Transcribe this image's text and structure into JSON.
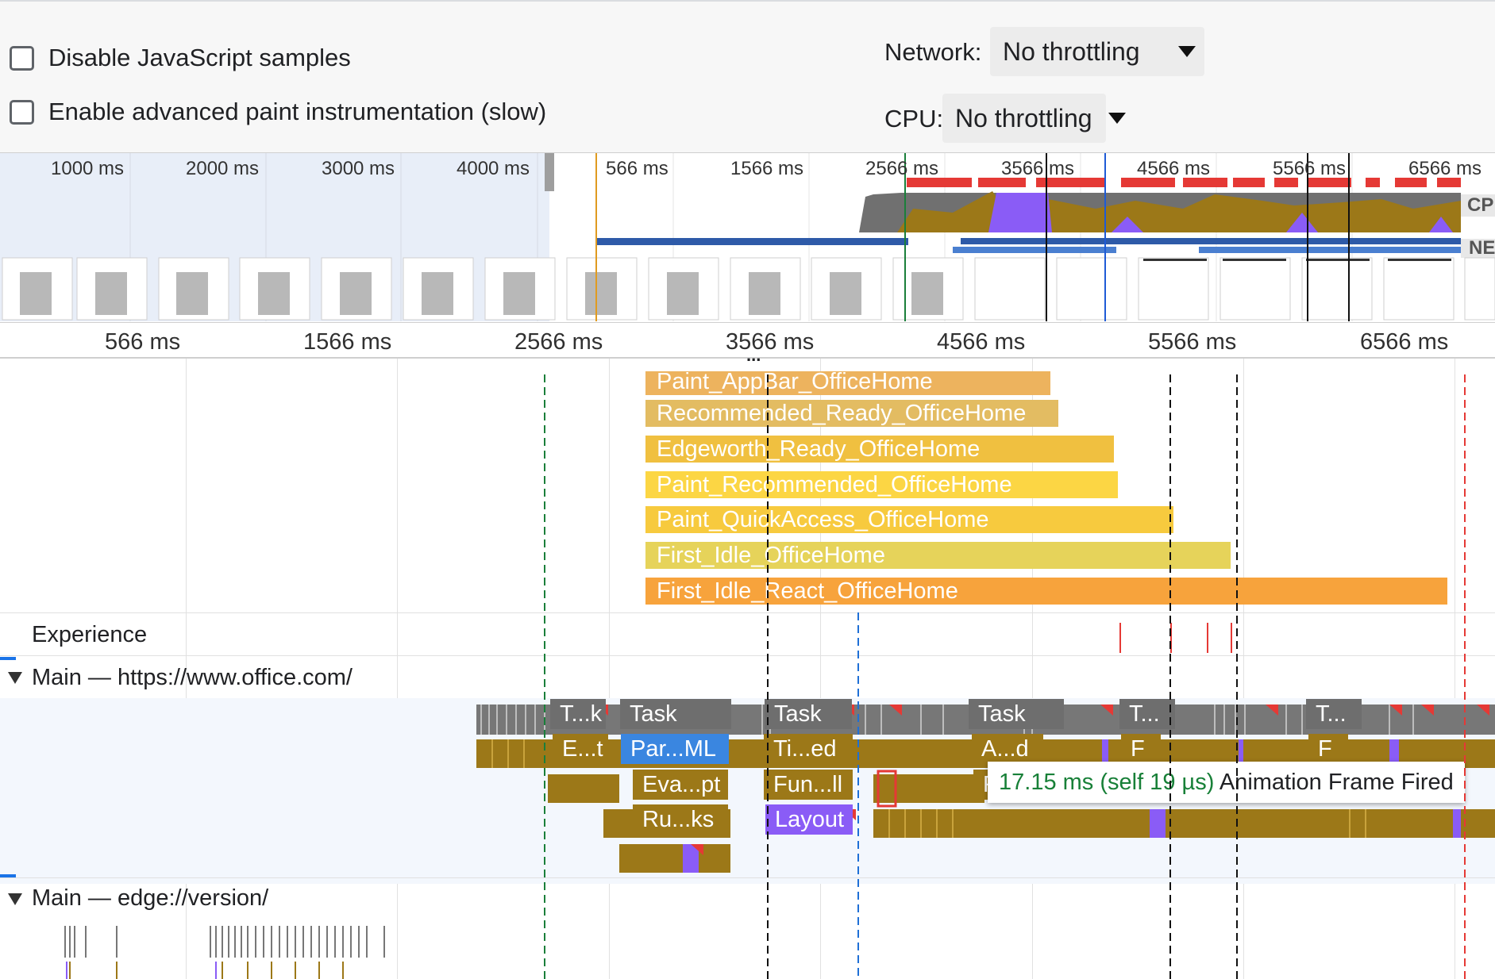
{
  "settings": {
    "disable_js_samples": "Disable JavaScript samples",
    "advanced_paint": "Enable advanced paint instrumentation (slow)",
    "network_label": "Network:",
    "network_value": "No throttling",
    "cpu_label": "CPU:",
    "cpu_value": "No throttling"
  },
  "overview": {
    "ticks_left": [
      "1000 ms",
      "2000 ms",
      "3000 ms",
      "4000 ms"
    ],
    "ticks_right": [
      "566 ms",
      "1566 ms",
      "2566 ms",
      "3566 ms",
      "4566 ms",
      "5566 ms",
      "6566 ms"
    ],
    "cpu_label": "CP",
    "net_label": "NE"
  },
  "ruler": {
    "ticks": [
      "566 ms",
      "1566 ms",
      "2566 ms",
      "3566 ms",
      "4566 ms",
      "5566 ms",
      "6566 ms"
    ],
    "ellipsis": "..."
  },
  "timings": [
    {
      "label": "Paint_AppBar_OfficeHome",
      "color": "#edb35e"
    },
    {
      "label": "Recommended_Ready_OfficeHome",
      "color": "#e3bc62"
    },
    {
      "label": "Edgeworth_Ready_OfficeHome",
      "color": "#f0c040"
    },
    {
      "label": "Paint_Recommended_OfficeHome",
      "color": "#fcd644"
    },
    {
      "label": "Paint_QuickAccess_OfficeHome",
      "color": "#f7ca3e"
    },
    {
      "label": "First_Idle_OfficeHome",
      "color": "#e6d35a"
    },
    {
      "label": "First_Idle_React_OfficeHome",
      "color": "#f7a33c"
    }
  ],
  "tracks": {
    "experience": "Experience",
    "main_office": "Main — https://www.office.com/",
    "main_edge": "Main — edge://version/"
  },
  "tasks": {
    "row1": [
      "T...k",
      "Task",
      "Task",
      "Task",
      "T...",
      "T..."
    ],
    "row2": [
      "E...t",
      "Par...ML",
      "Ti...ed",
      "A...d",
      "F",
      "F"
    ],
    "row3": [
      "Eva...pt",
      "Fun...ll",
      "F"
    ],
    "row4": [
      "Ru...ks",
      "Layout"
    ]
  },
  "tooltip": {
    "time": "17.15 ms (self 19 µs)",
    "name": "Animation Frame Fired"
  },
  "colors": {
    "task_gray": "#6e6e6e",
    "scripting": "#9c7818",
    "rendering": "#8a5cf6",
    "parse": "#3a86e0",
    "long_task_red": "#e53935"
  }
}
